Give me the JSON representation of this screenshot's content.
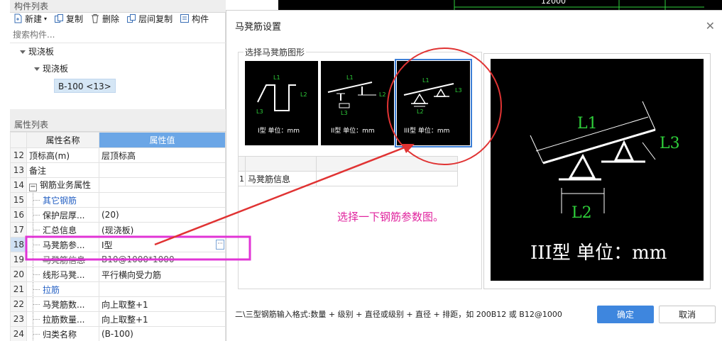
{
  "left_panel": {
    "component_list_title": "构件列表",
    "toolbar": {
      "new_label": "新建",
      "copy_label": "复制",
      "delete_label": "删除",
      "floor_copy_label": "层间复制",
      "more_label": "构件"
    },
    "search_placeholder": "搜索构件...",
    "tree": {
      "root": "现浇板",
      "child": "现浇板",
      "leaf": "B-100 <13>"
    },
    "property_list_title": "属性列表",
    "prop_headers": {
      "name": "属性名称",
      "value": "属性值"
    },
    "props": [
      {
        "no": "12",
        "name": "顶标高(m)",
        "value": "层顶标高"
      },
      {
        "no": "13",
        "name": "备注",
        "value": ""
      },
      {
        "no": "14",
        "name": "钢筋业务属性",
        "value": ""
      },
      {
        "no": "15",
        "name": "其它钢筋",
        "value": ""
      },
      {
        "no": "16",
        "name": "保护层厚...",
        "value": "(20)"
      },
      {
        "no": "17",
        "name": "汇总信息",
        "value": "(现浇板)"
      },
      {
        "no": "18",
        "name": "马凳筋参...",
        "value": "Ⅰ型"
      },
      {
        "no": "19",
        "name": "马凳筋信息",
        "value": "B10@1000*1000"
      },
      {
        "no": "20",
        "name": "线形马凳...",
        "value": "平行横向受力筋"
      },
      {
        "no": "21",
        "name": "拉筋",
        "value": ""
      },
      {
        "no": "22",
        "name": "马凳筋数...",
        "value": "向上取整+1"
      },
      {
        "no": "23",
        "name": "拉筋数量...",
        "value": "向上取整+1"
      },
      {
        "no": "24",
        "name": "归类名称",
        "value": "(B-100)"
      }
    ]
  },
  "canvas_top": {
    "dimension_label": "12000"
  },
  "dialog": {
    "title": "马凳筋设置",
    "group_label": "选择马凳筋图形",
    "thumbnails": [
      {
        "caption": "I型 单位：mm"
      },
      {
        "caption": "II型 单位：mm"
      },
      {
        "caption": "III型 单位：mm"
      }
    ],
    "info_table": {
      "row_no": "1",
      "row_label": "马凳筋信息",
      "row_value": ""
    },
    "preview": {
      "l1": "L1",
      "l2": "L2",
      "l3": "L3",
      "caption": "III型 单位：mm"
    },
    "hint": "二\\三型钢筋输入格式:数量 + 级别 + 直径或级别 + 直径 + 排距，如 200B12 或 B12@1000",
    "ok_label": "确定",
    "cancel_label": "取消"
  },
  "annotation": {
    "note": "选择一下钢筋参数图。",
    "color": "#e0249e",
    "circle_color": "#e03333"
  }
}
